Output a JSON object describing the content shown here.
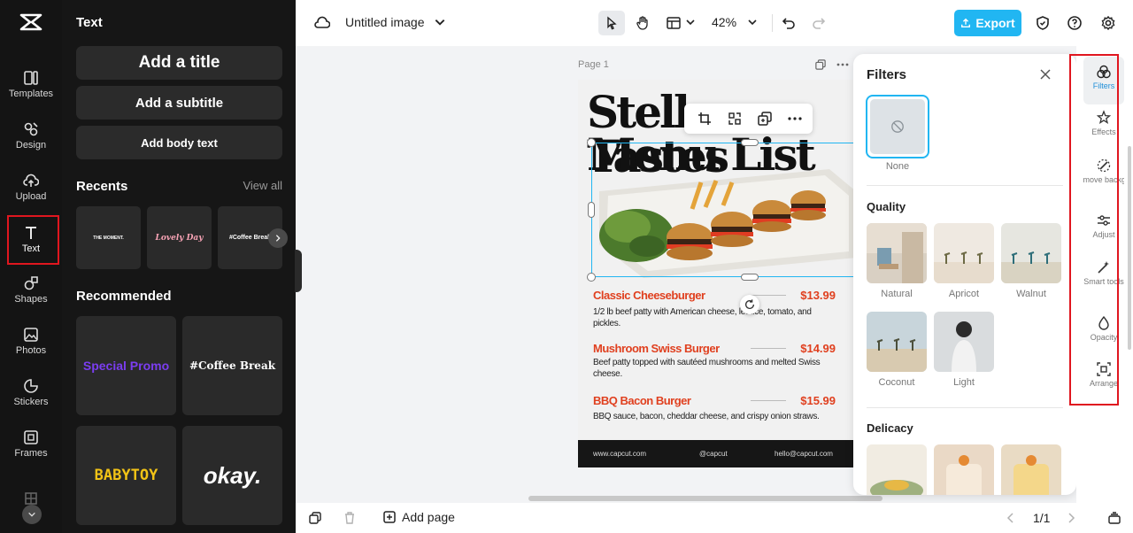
{
  "colors": {
    "accent": "#21b6f2",
    "highlight": "#e0161f",
    "menu_red": "#e0401f",
    "dark": "#141414"
  },
  "rail": {
    "items": [
      {
        "label": "Templates",
        "icon": "templates-icon"
      },
      {
        "label": "Design",
        "icon": "design-icon"
      },
      {
        "label": "Upload",
        "icon": "upload-icon"
      },
      {
        "label": "Text",
        "icon": "text-icon",
        "active": true
      },
      {
        "label": "Shapes",
        "icon": "shapes-icon"
      },
      {
        "label": "Photos",
        "icon": "photos-icon"
      },
      {
        "label": "Stickers",
        "icon": "stickers-icon"
      },
      {
        "label": "Frames",
        "icon": "frames-icon"
      }
    ]
  },
  "panel": {
    "title": "Text",
    "add_title": "Add a title",
    "add_subtitle": "Add a subtitle",
    "add_body": "Add body text",
    "recents_heading": "Recents",
    "view_all": "View all",
    "recents": [
      "THE MOMENT.",
      "Lovely Day",
      "#Coffee Break"
    ],
    "recommended_heading": "Recommended",
    "recommended": [
      "Special Promo",
      "#Coffee Break",
      "BABYTOY",
      "okay."
    ]
  },
  "topbar": {
    "doc_title": "Untitled image",
    "zoom": "42%",
    "export_label": "Export"
  },
  "canvas": {
    "page_label": "Page 1",
    "design_title_line1": "Stella Tastes",
    "design_title_line2": "Menu List",
    "menu_items": [
      {
        "name": "Classic Cheeseburger",
        "price": "$13.99",
        "desc": "1/2 lb beef patty with American cheese, lettuce, tomato, and pickles."
      },
      {
        "name": "Mushroom Swiss Burger",
        "price": "$14.99",
        "desc": "Beef patty topped with sautéed mushrooms and melted Swiss cheese."
      },
      {
        "name": "BBQ Bacon Burger",
        "price": "$15.99",
        "desc": "BBQ sauce, bacon, cheddar cheese, and crispy onion straws."
      }
    ],
    "footer": {
      "website": "www.capcut.com",
      "handle": "@capcut",
      "email": "hello@capcut.com"
    }
  },
  "filters": {
    "title": "Filters",
    "none_label": "None",
    "quality_heading": "Quality",
    "quality": [
      "Natural",
      "Apricot",
      "Walnut",
      "Coconut",
      "Light"
    ],
    "delicacy_heading": "Delicacy"
  },
  "tools": {
    "items": [
      {
        "label": "Filters",
        "icon": "filters-icon",
        "active": true
      },
      {
        "label": "Effects",
        "icon": "effects-icon"
      },
      {
        "label": "Remove backgr...",
        "icon": "remove-background-icon"
      },
      {
        "label": "Adjust",
        "icon": "adjust-icon"
      },
      {
        "label": "Smart tools",
        "icon": "smart-tools-icon"
      },
      {
        "label": "Opacity",
        "icon": "opacity-icon"
      },
      {
        "label": "Arrange",
        "icon": "arrange-icon"
      }
    ]
  },
  "bottombar": {
    "add_page": "Add page",
    "page_counter": "1/1"
  }
}
